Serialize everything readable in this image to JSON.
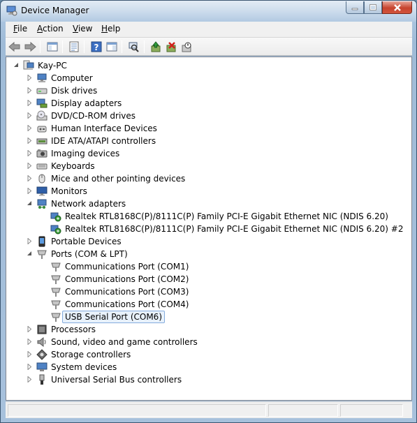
{
  "window": {
    "title": "Device Manager"
  },
  "menu": {
    "items": [
      {
        "label": "File",
        "accel": "F",
        "rest": "ile"
      },
      {
        "label": "Action",
        "accel": "A",
        "rest": "ction"
      },
      {
        "label": "View",
        "accel": "V",
        "rest": "iew"
      },
      {
        "label": "Help",
        "accel": "H",
        "rest": "elp"
      }
    ]
  },
  "toolbar": {
    "buttons": [
      "back-icon",
      "forward-icon",
      "up-icon",
      "properties-icon",
      "help-icon",
      "show-hide-icon",
      "scan-hardware-icon",
      "update-driver-icon",
      "uninstall-icon",
      "disable-icon"
    ]
  },
  "tree": {
    "root": "Kay-PC",
    "categories": [
      {
        "label": "Computer",
        "icon": "computer-icon",
        "expanded": false
      },
      {
        "label": "Disk drives",
        "icon": "disk-drive-icon",
        "expanded": false
      },
      {
        "label": "Display adapters",
        "icon": "display-adapter-icon",
        "expanded": false
      },
      {
        "label": "DVD/CD-ROM drives",
        "icon": "dvd-drive-icon",
        "expanded": false
      },
      {
        "label": "Human Interface Devices",
        "icon": "hid-icon",
        "expanded": false
      },
      {
        "label": "IDE ATA/ATAPI controllers",
        "icon": "ide-controller-icon",
        "expanded": false
      },
      {
        "label": "Imaging devices",
        "icon": "imaging-device-icon",
        "expanded": false
      },
      {
        "label": "Keyboards",
        "icon": "keyboard-icon",
        "expanded": false
      },
      {
        "label": "Mice and other pointing devices",
        "icon": "mouse-icon",
        "expanded": false
      },
      {
        "label": "Monitors",
        "icon": "monitor-icon",
        "expanded": false
      },
      {
        "label": "Network adapters",
        "icon": "network-adapter-icon",
        "expanded": true,
        "children": [
          "Realtek RTL8168C(P)/8111C(P) Family PCI-E Gigabit Ethernet NIC (NDIS 6.20)",
          "Realtek RTL8168C(P)/8111C(P) Family PCI-E Gigabit Ethernet NIC (NDIS 6.20) #2"
        ]
      },
      {
        "label": "Portable Devices",
        "icon": "portable-device-icon",
        "expanded": false
      },
      {
        "label": "Ports (COM & LPT)",
        "icon": "port-icon",
        "expanded": true,
        "children": [
          "Communications Port (COM1)",
          "Communications Port (COM2)",
          "Communications Port (COM3)",
          "Communications Port (COM4)",
          "USB Serial Port (COM6)"
        ],
        "selected_child": "USB Serial Port (COM6)"
      },
      {
        "label": "Processors",
        "icon": "processor-icon",
        "expanded": false
      },
      {
        "label": "Sound, video and game controllers",
        "icon": "sound-icon",
        "expanded": false
      },
      {
        "label": "Storage controllers",
        "icon": "storage-controller-icon",
        "expanded": false
      },
      {
        "label": "System devices",
        "icon": "system-device-icon",
        "expanded": false
      },
      {
        "label": "Universal Serial Bus controllers",
        "icon": "usb-icon",
        "expanded": false
      }
    ]
  }
}
